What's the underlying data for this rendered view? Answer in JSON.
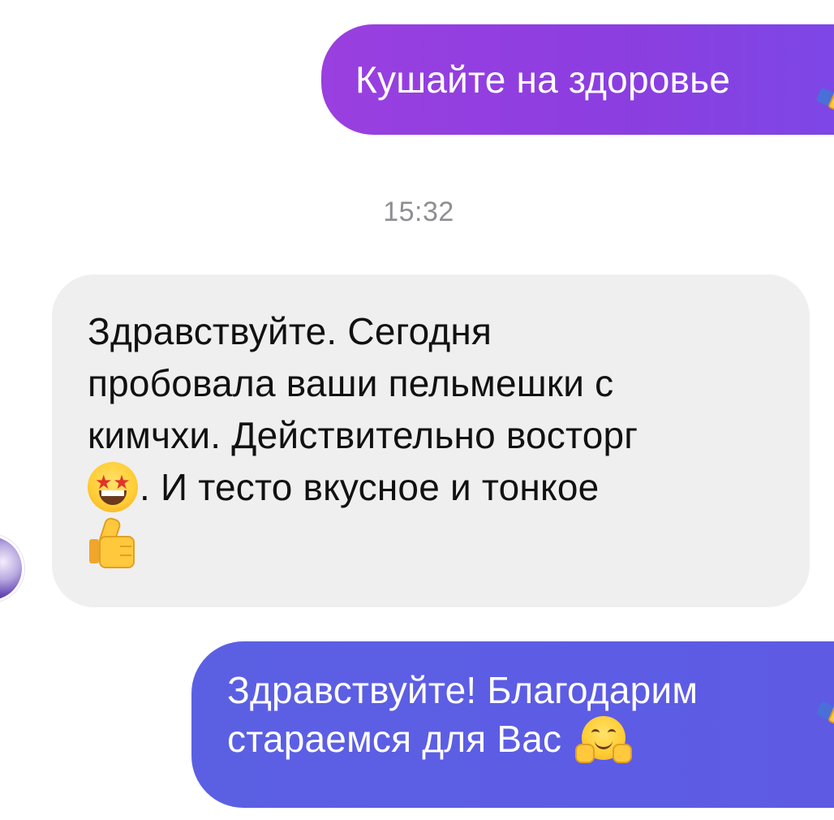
{
  "conversation": {
    "messages": [
      {
        "direction": "outgoing",
        "lines": [
          "Кушайте на здоровье"
        ],
        "trailing_icon": "folded-hands-emoji",
        "color": "#8b3ee0"
      },
      {
        "direction": "incoming",
        "lines": [
          "Здравствуйте. Сегодня",
          "пробовала ваши пельмешки с",
          "кимчхи. Действительно восторг",
          ". И тесто вкусное и тонкое"
        ],
        "inline_icons": [
          "star-struck-emoji",
          "thumbs-up-emoji"
        ],
        "color": "#efefef"
      },
      {
        "direction": "outgoing",
        "lines": [
          "Здравствуйте! Благодарим",
          "стараемся для Вас"
        ],
        "inline_icons": [
          "hugging-face-emoji",
          "folded-hands-emoji"
        ],
        "color": "#5b60e3"
      }
    ],
    "timestamp": "15:32"
  },
  "colors": {
    "outgoing_purple": "#8b3ee0",
    "outgoing_indigo": "#5b60e3",
    "incoming_gray": "#efefef",
    "timestamp_gray": "#8e8e93"
  }
}
